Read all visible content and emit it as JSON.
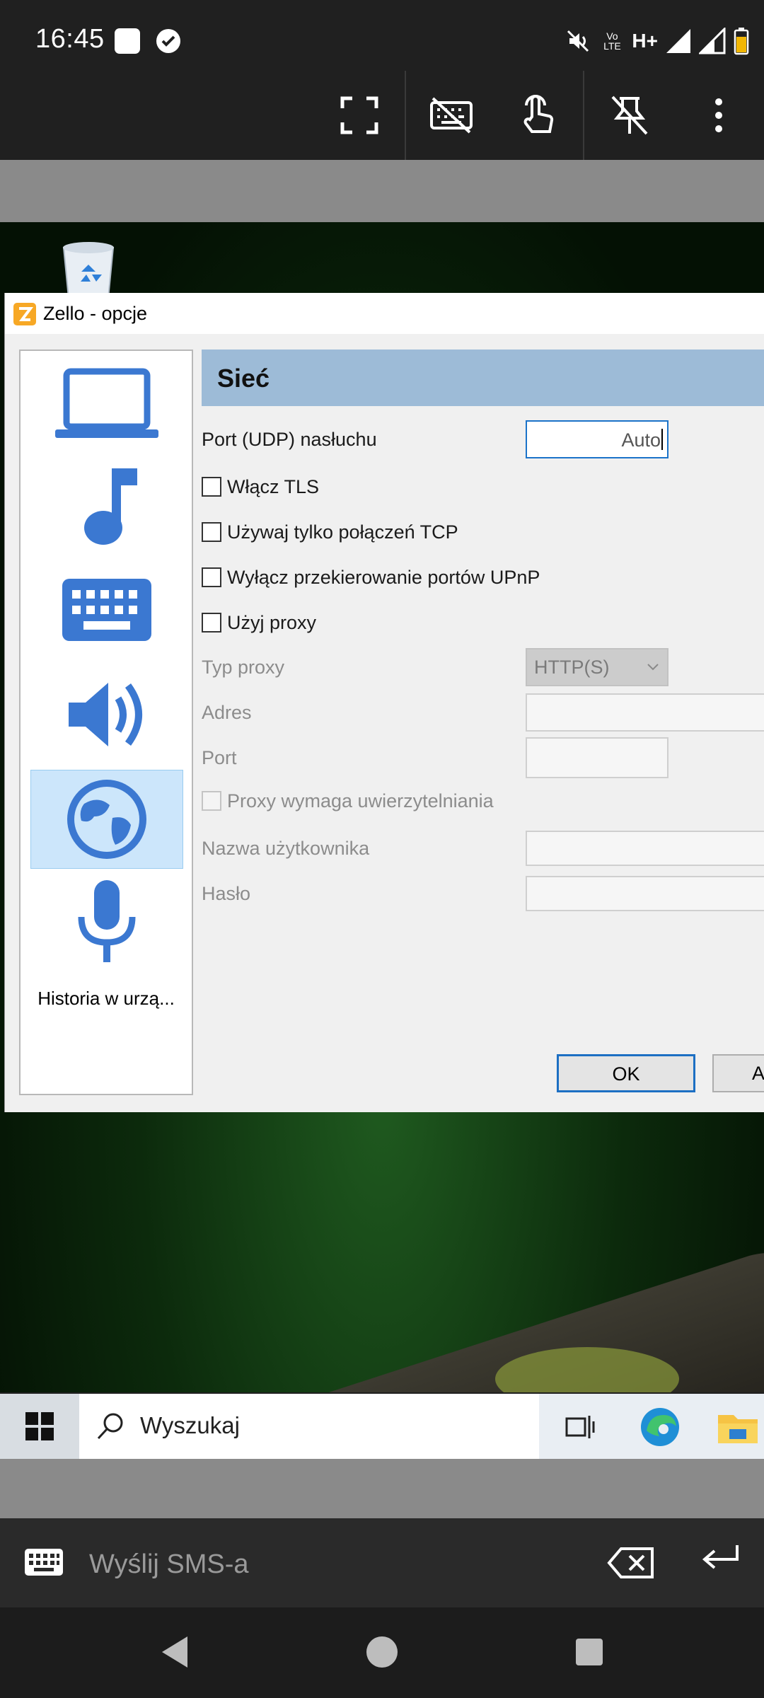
{
  "status_bar": {
    "time": "16:45",
    "network_label": "H+",
    "volte_label": "Vo LTE"
  },
  "remote_toolbar": {
    "icons": [
      "fullscreen-icon",
      "keyboard-off-icon",
      "touch-mode-icon",
      "pin-off-icon",
      "more-vert-icon"
    ]
  },
  "dialog": {
    "title": "Zello - opcje",
    "section_title": "Sieć",
    "sidebar": {
      "items": [
        "laptop-icon",
        "music-note-icon",
        "keyboard-icon",
        "speaker-icon",
        "globe-icon",
        "microphone-icon"
      ],
      "selected": "globe-icon",
      "history_label": "Historia w urzą..."
    },
    "fields": {
      "port_label": "Port (UDP) nasłuchu",
      "port_value": "Auto",
      "tls_label": "Włącz TLS",
      "tcp_label": "Używaj tylko połączeń TCP",
      "upnp_label": "Wyłącz przekierowanie portów UPnP",
      "proxy_label": "Użyj proxy",
      "proxy_type_label": "Typ proxy",
      "proxy_type_value": "HTTP(S)",
      "address_label": "Adres",
      "port2_label": "Port",
      "proxy_auth_label": "Proxy wymaga uwierzytelniania",
      "username_label": "Nazwa użytkownika",
      "password_label": "Hasło"
    },
    "buttons": {
      "ok": "OK",
      "cancel": "A"
    },
    "colors": {
      "header": "#9dbbd7",
      "selected": "#cce6fb",
      "icon": "#3b78d1"
    }
  },
  "taskbar": {
    "search_placeholder": "Wyszukaj",
    "icons": [
      "windows-start-icon",
      "task-view-icon",
      "edge-icon",
      "file-explorer-icon"
    ]
  },
  "sms_bar": {
    "placeholder": "Wyślij SMS-a"
  },
  "nav_bar": {
    "buttons": [
      "back-icon",
      "home-icon",
      "recents-icon"
    ]
  }
}
